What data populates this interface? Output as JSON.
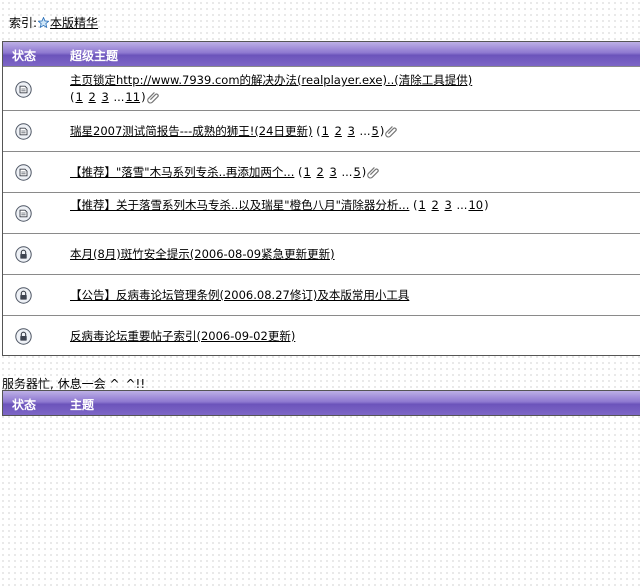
{
  "breadcrumb": {
    "prefix": "索引:",
    "icon": "star-icon",
    "link": "本版精华"
  },
  "top_table": {
    "col_status": "状态",
    "col_topic": "超级主题",
    "rows": [
      {
        "icon": "locked-doc-icon",
        "title": "主页锁定http://www.7939.com的解决办法(realplayer.exe)..(清除工具提供)",
        "open": "(",
        "pages": [
          "1",
          "2",
          "3"
        ],
        "ell": "...",
        "last": "11",
        "close": ")",
        "attachment": true
      },
      {
        "icon": "locked-doc-icon",
        "title": "瑞星2007测试简报告---成熟的狮王!(24日更新)",
        "open": "(",
        "pages": [
          "1",
          "2",
          "3"
        ],
        "ell": "...",
        "last": "5",
        "close": ")",
        "attachment": true
      },
      {
        "icon": "locked-doc-icon",
        "title": "【推荐】\"落雪\"木马系列专杀..再添加两个...",
        "open": "(",
        "pages": [
          "1",
          "2",
          "3"
        ],
        "ell": "...",
        "last": "5",
        "close": ")",
        "attachment": true
      },
      {
        "icon": "locked-doc-icon",
        "title": "【推荐】关于落雪系列木马专杀..以及瑞星\"橙色八月\"清除器分析...",
        "open": "(",
        "pages": [
          "1",
          "2",
          "3"
        ],
        "ell": "...",
        "last": "10",
        "close": ")",
        "attachment": false
      },
      {
        "icon": "padlock-icon",
        "title": "本月(8月)斑竹安全提示(2006-08-09紧急更新更新)"
      },
      {
        "icon": "padlock-icon",
        "title": "【公告】反病毒论坛管理条例(2006.08.27修订)及本版常用小工具"
      },
      {
        "icon": "padlock-icon",
        "title": "反病毒论坛重要帖子索引(2006-09-02更新)"
      }
    ]
  },
  "busy_message": "服务器忙, 休息一会 ^_^!!",
  "bottom_table": {
    "col_status": "状态",
    "col_topic": "主题"
  },
  "colors": {
    "header_top": "#bdb0e6",
    "header_mid": "#6c54bb",
    "border": "#555555"
  }
}
